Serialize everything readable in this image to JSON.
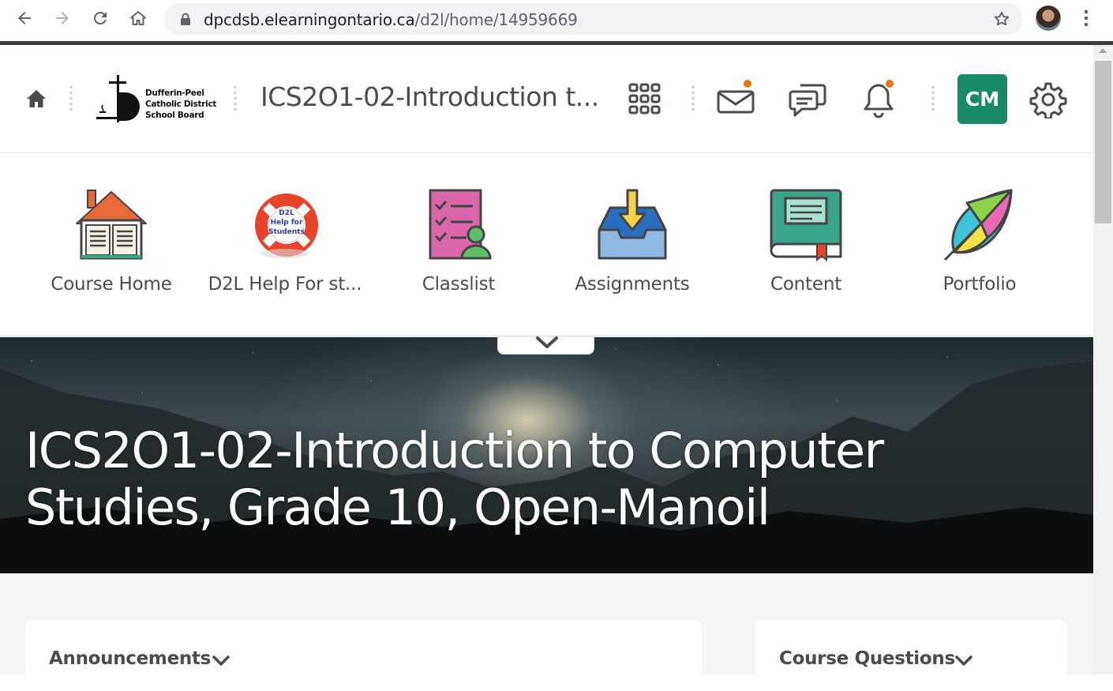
{
  "browser": {
    "url_host": "dpcdsb.elearningontario.ca",
    "url_path": "/d2l/home/14959669",
    "icons": [
      "back-icon",
      "forward-icon",
      "reload-icon",
      "home-icon",
      "lock-icon",
      "bookmark-star-icon",
      "profile-avatar",
      "menu-kebab-icon"
    ]
  },
  "header": {
    "logo_lines": [
      "Dufferin-Peel",
      "Catholic District",
      "School Board"
    ],
    "course_title": "ICS2O1-02-Introduction t...",
    "avatar_initials": "CM",
    "accent_color": "#1a8a6b",
    "notification_color": "#e87511",
    "icons": [
      "home-icon",
      "course-selector-grid-icon",
      "message-alerts-icon",
      "subscription-alerts-icon",
      "update-alerts-icon",
      "settings-gear-icon"
    ]
  },
  "navbar": {
    "items": [
      {
        "label": "Course Home",
        "icon": "course-home-icon"
      },
      {
        "label": "D2L Help For st...",
        "icon": "d2l-help-lifebuoy-icon"
      },
      {
        "label": "Classlist",
        "icon": "classlist-icon"
      },
      {
        "label": "Assignments",
        "icon": "assignments-inbox-icon"
      },
      {
        "label": "Content",
        "icon": "content-book-icon"
      },
      {
        "label": "Portfolio",
        "icon": "portfolio-leaf-icon"
      }
    ],
    "help_badge_lines": [
      "D2L",
      "Help for",
      "Students"
    ]
  },
  "banner": {
    "title": "ICS2O1-02-Introduction to Computer Studies, Grade 10, Open-Manoil"
  },
  "widgets": [
    {
      "title": "Announcements"
    },
    {
      "title": "Course Questions"
    }
  ]
}
